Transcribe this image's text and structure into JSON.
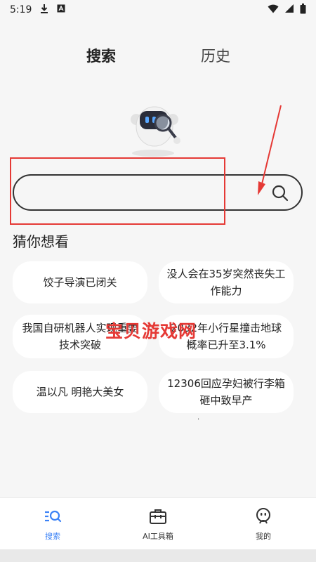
{
  "status_bar": {
    "time": "5:19"
  },
  "tabs": [
    {
      "label": "搜索"
    },
    {
      "label": "历史"
    }
  ],
  "search": {
    "placeholder": ""
  },
  "suggestions": {
    "title": "猜你想看",
    "items": [
      {
        "label": "饺子导演已闭关"
      },
      {
        "label": "没人会在35岁突然丧失工作能力"
      },
      {
        "label": "我国自研机器人实现重要技术突破"
      },
      {
        "label": "2032年小行星撞击地球概率已升至3.1%"
      },
      {
        "label": "温以凡 明艳大美女"
      },
      {
        "label": "12306回应孕妇被行李箱砸中致早产"
      }
    ]
  },
  "watermark": "宝贝游戏网",
  "bottom_nav": [
    {
      "label": "搜索",
      "icon": "search-list-icon",
      "active": true
    },
    {
      "label": "AI工具箱",
      "icon": "toolbox-icon",
      "active": false
    },
    {
      "label": "我的",
      "icon": "robot-face-icon",
      "active": false
    }
  ],
  "colors": {
    "accent": "#3b82f6",
    "annotation_red": "#e53935",
    "background": "#f6f6f6"
  }
}
